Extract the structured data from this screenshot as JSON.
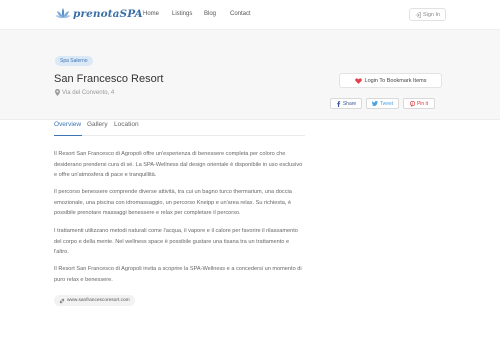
{
  "brand": {
    "name": "prenotaSPA",
    "logo_icon": "lotus-flower-icon"
  },
  "nav": {
    "items": [
      "Home",
      "Listings",
      "Blog",
      "Contact"
    ]
  },
  "auth": {
    "signin_label": "Sign In",
    "icon": "signin-icon"
  },
  "listing": {
    "category_tag": "Spa Salerno",
    "title": "San Francesco Resort",
    "address": "Via del Convento, 4",
    "bookmark_label": "Login To Bookmark Items",
    "share": {
      "facebook": "Share",
      "twitter": "Tweet",
      "pinterest": "Pin it"
    }
  },
  "tabs": [
    "Overview",
    "Gallery",
    "Location"
  ],
  "overview": {
    "paragraphs": [
      "Il Resort San Francesco di Agropoli offre un'esperienza di benessere completa per coloro che desiderano prendersi cura di sé. La SPA-Wellness dal design orientale è disponibile in uso esclusivo e offre un'atmosfera di pace e tranquillità.",
      "Il percorso benessere comprende diverse attività, tra cui un bagno turco thermarium, una doccia emozionale, una piscina con idromassaggio, un percorso Kneipp e un'area relax. Su richiesta, è possibile prenotare massaggi benessere e relax per completare il percorso.",
      "I trattamenti utilizzano metodi naturali come l'acqua, il vapore e il calore per favorire il rilassamento del corpo e della mente. Nel wellness space è possibile gustare una tisana tra un trattamento e l'altro.",
      "Il Resort San Francesco di Agropoli invita a scoprire la SPA-Wellness e a concedersi un momento di puro relax e benessere."
    ],
    "website": "www.sanfrancescoresort.com"
  },
  "colors": {
    "accent": "#3d74b3",
    "heart": "#e0434e",
    "twitter": "#4aa3df",
    "pinterest": "#d9363e",
    "facebook": "#3b5998"
  }
}
